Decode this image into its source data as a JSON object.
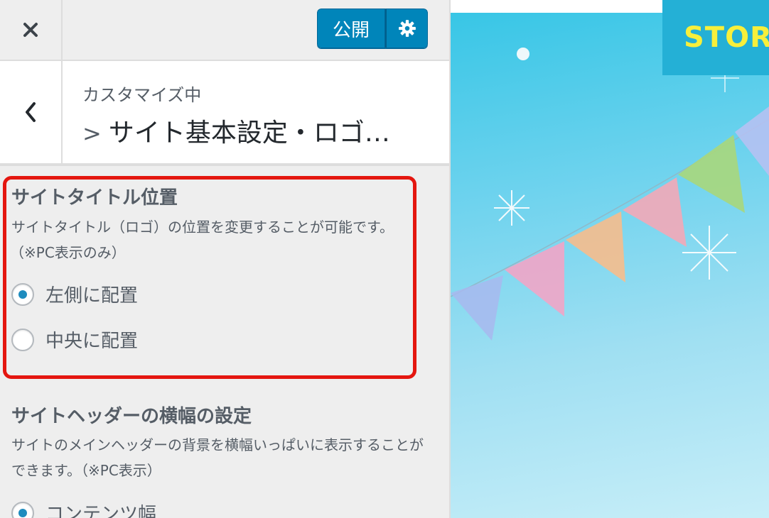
{
  "topbar": {
    "close_icon": "close-icon",
    "publish_label": "公開",
    "settings_icon": "gear-icon",
    "accent_color": "#0085ba"
  },
  "section": {
    "back_icon": "chevron-left-icon",
    "customizing_label": "カスタマイズ中",
    "arrow": ">",
    "title": "サイト基本設定・ロゴ…"
  },
  "controls": [
    {
      "title": "サイトタイトル位置",
      "description_line1": "サイトタイトル（ロゴ）の位置を変更することが可能です。",
      "description_line2": "（※PC表示のみ）",
      "options": [
        {
          "label": "左側に配置",
          "checked": true
        },
        {
          "label": "中央に配置",
          "checked": false
        }
      ],
      "highlight_color": "#e4160f"
    },
    {
      "title": "サイトヘッダーの横幅の設定",
      "description_line1": "サイトのメインヘッダーの背景を横幅いっぱいに表示することが",
      "description_line2": "できます。（※PC表示）",
      "options": [
        {
          "label": "コンテンツ幅",
          "checked": true
        }
      ]
    }
  ],
  "preview": {
    "logo_text": "STORK",
    "logo_color": "#f7ef3b",
    "header_color": "#24b0d6",
    "background": "sky-blue watercolor with bunting flags"
  }
}
